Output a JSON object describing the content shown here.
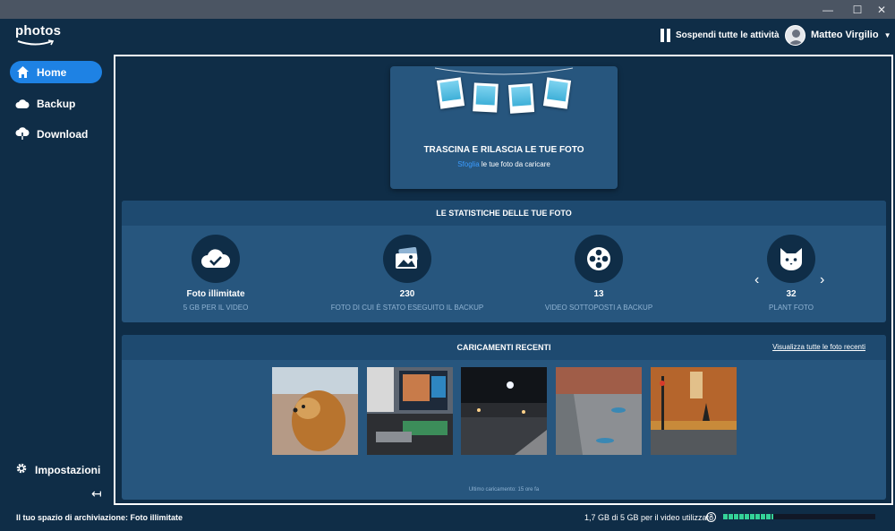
{
  "window": {
    "minimize": "—",
    "maximize": "☐",
    "close": "✕"
  },
  "header": {
    "logo": "photos",
    "pause_label": "Sospendi tutte le attività",
    "user_name": "Matteo Virgilio"
  },
  "sidebar": {
    "items": [
      {
        "label": "Home",
        "icon": "home-icon",
        "active": true
      },
      {
        "label": "Backup",
        "icon": "cloud-icon",
        "active": false
      },
      {
        "label": "Download",
        "icon": "cloud-download-icon",
        "active": false
      }
    ],
    "settings_label": "Impostazioni",
    "collapse_glyph": "↤"
  },
  "drop": {
    "title": "TRASCINA E RILASCIA LE TUE FOTO",
    "browse_link": "Sfoglia",
    "browse_rest": " le tue foto da caricare"
  },
  "stats": {
    "title": "LE STATISTICHE DELLE TUE FOTO",
    "items": [
      {
        "value": "Foto illimitate",
        "label": "5 GB PER IL VIDEO",
        "icon": "cloud-check-icon"
      },
      {
        "value": "230",
        "label": "FOTO DI CUI È STATO ESEGUITO IL BACKUP",
        "icon": "photos-icon"
      },
      {
        "value": "13",
        "label": "VIDEO SOTTOPOSTI A BACKUP",
        "icon": "film-reel-icon"
      },
      {
        "value": "32",
        "label": "PLANT FOTO",
        "icon": "cat-icon"
      }
    ],
    "prev": "‹",
    "next": "›"
  },
  "recent": {
    "title": "CARICAMENTI RECENTI",
    "view_all": "Visualizza tutte le foto recenti",
    "last_upload": "Ultimo caricamento: 15 ore fa"
  },
  "footer": {
    "storage": "Il tuo spazio di archiviazione: Foto illimitate",
    "usage": "1,7 GB di 5 GB per il video utilizzato",
    "help": "?",
    "usage_fraction": 0.33
  },
  "colors": {
    "accent": "#1e82e4",
    "panel": "#27567e",
    "background": "#0f2d47",
    "progress": "#34d399"
  }
}
